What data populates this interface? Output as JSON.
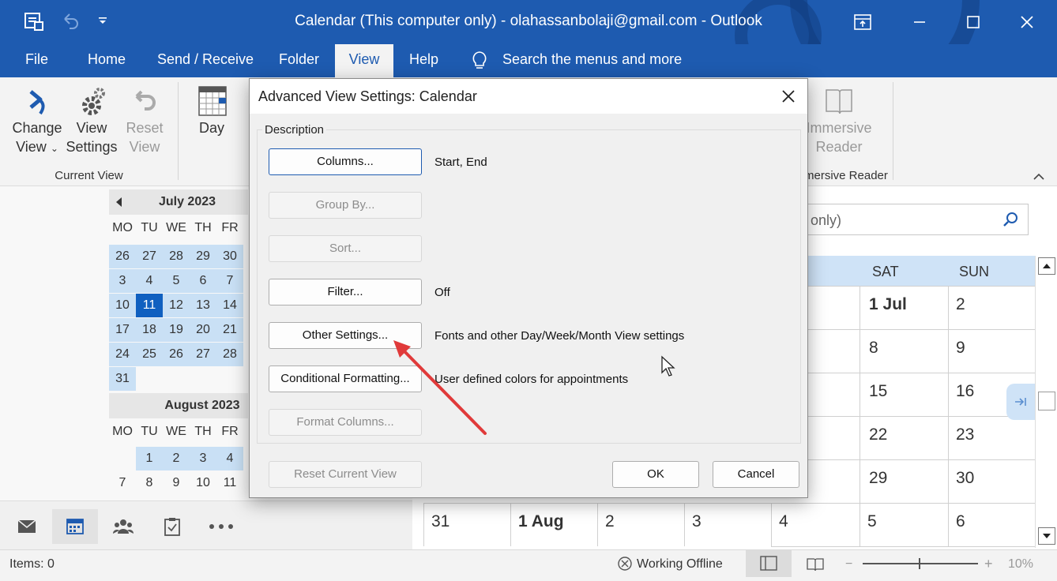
{
  "window": {
    "title": "Calendar (This computer only) - olahassanbolaji@gmail.com  -  Outlook"
  },
  "menu": {
    "file": "File",
    "home": "Home",
    "send_receive": "Send / Receive",
    "folder": "Folder",
    "view": "View",
    "help": "Help",
    "search": "Search the menus and more"
  },
  "ribbon": {
    "change_view_1": "Change",
    "change_view_2": "View",
    "view_settings_1": "View",
    "view_settings_2": "Settings",
    "reset_view_1": "Reset",
    "reset_view_2": "View",
    "day": "Day",
    "current_view_group": "Current View",
    "immersive_reader_1": "Immersive",
    "immersive_reader_2": "Reader",
    "immersive_group": "mersive Reader"
  },
  "dialog": {
    "title": "Advanced View Settings: Calendar",
    "group_label": "Description",
    "buttons": {
      "columns": "Columns...",
      "group_by": "Group By...",
      "sort": "Sort...",
      "filter": "Filter...",
      "other_settings": "Other Settings...",
      "conditional_formatting": "Conditional Formatting...",
      "format_columns": "Format Columns...",
      "reset_current_view": "Reset Current View",
      "ok": "OK",
      "cancel": "Cancel"
    },
    "values": {
      "columns": "Start, End",
      "filter": "Off",
      "other_settings": "Fonts and other Day/Week/Month View settings",
      "conditional_formatting": "User defined colors for appointments"
    }
  },
  "nav": {
    "july": {
      "title": "July 2023",
      "dow": [
        "MO",
        "TU",
        "WE",
        "TH",
        "FR"
      ],
      "rows": [
        [
          "26",
          "27",
          "28",
          "29",
          "30"
        ],
        [
          "3",
          "4",
          "5",
          "6",
          "7"
        ],
        [
          "10",
          "11",
          "12",
          "13",
          "14"
        ],
        [
          "17",
          "18",
          "19",
          "20",
          "21"
        ],
        [
          "24",
          "25",
          "26",
          "27",
          "28"
        ],
        [
          "31"
        ]
      ]
    },
    "august": {
      "title": "August 2023",
      "dow": [
        "MO",
        "TU",
        "WE",
        "TH",
        "FR"
      ],
      "rows": [
        [
          "",
          "1",
          "2",
          "3",
          "4"
        ],
        [
          "7",
          "8",
          "9",
          "10",
          "11"
        ]
      ]
    }
  },
  "calendar": {
    "search_partial": "er only)",
    "col_sat": "SAT",
    "col_sun": "SUN",
    "sat": [
      "1 Jul",
      "8",
      "15",
      "22",
      "29"
    ],
    "sun": [
      "2",
      "9",
      "16",
      "23",
      "30"
    ],
    "last_row": [
      "31",
      "1 Aug",
      "2",
      "3",
      "4",
      "5",
      "6"
    ]
  },
  "status": {
    "items": "Items: 0",
    "offline": "Working Offline",
    "zoom": "10%"
  },
  "colors": {
    "brand": "#1e5bb0",
    "selected_day": "#1060c0",
    "week_highlight": "#c9e0f5",
    "arrow": "#e03a3a"
  }
}
